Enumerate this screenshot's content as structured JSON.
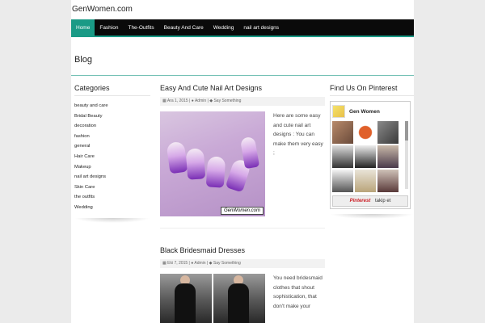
{
  "site": {
    "title": "GenWomen.com"
  },
  "nav": {
    "items": [
      {
        "label": "Home",
        "active": true
      },
      {
        "label": "Fashion"
      },
      {
        "label": "The-Outfits"
      },
      {
        "label": "Beauty And Care"
      },
      {
        "label": "Wedding"
      },
      {
        "label": "nail art designs"
      }
    ]
  },
  "page": {
    "title": "Blog"
  },
  "categories": {
    "title": "Categories",
    "items": [
      "beauty and care",
      "Bridal Beauty",
      "decoration",
      "fashion",
      "general",
      "Hair Care",
      "Makeup",
      "nail art designs",
      "Skin Care",
      "the outfits",
      "Wedding"
    ]
  },
  "posts": [
    {
      "title": "Easy And Cute Nail Art Designs",
      "date": "Ara 1, 2015",
      "author": "Admin",
      "comments": "Say Something",
      "excerpt": "Here are some easy and cute nail art designs : You can make them very easy ;",
      "image_label": "GenWomen.com"
    },
    {
      "title": "Black Bridesmaid Dresses",
      "date": "Eki 7, 2015",
      "author": "Admin",
      "comments": "Say Something",
      "excerpt": "You need bridesmaid clothes that shout sophistication, that don't make your"
    }
  ],
  "pinterest": {
    "title": "Find Us On Pinterest",
    "name": "Gen Women",
    "logo_text": "Pinterest",
    "follow_label": "takip et"
  },
  "colors": {
    "accent": "#1a9a86",
    "nav_bg": "#0a0a0a"
  }
}
